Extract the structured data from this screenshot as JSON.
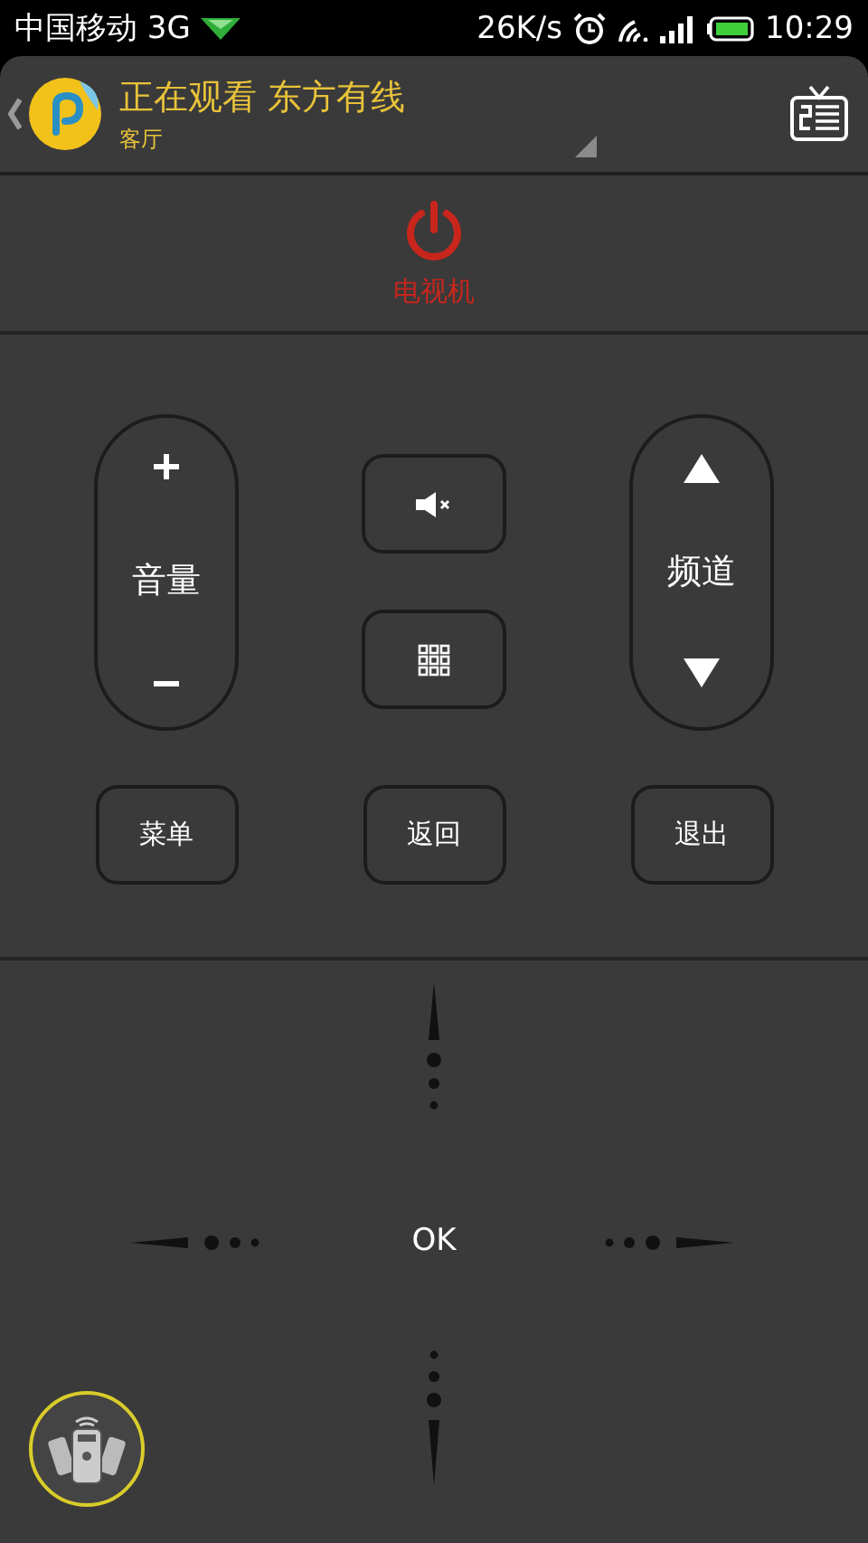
{
  "status_bar": {
    "carrier": "中国移动 3G",
    "speed": "26K/s",
    "time": "10:29"
  },
  "header": {
    "title": "正在观看 东方有线",
    "subtitle": "客厅"
  },
  "power": {
    "label": "电视机"
  },
  "volume": {
    "label": "音量"
  },
  "channel": {
    "label": "频道"
  },
  "buttons": [
    {
      "label": "菜单"
    },
    {
      "label": "返回"
    },
    {
      "label": "退出"
    }
  ],
  "dpad": {
    "center": "OK"
  }
}
